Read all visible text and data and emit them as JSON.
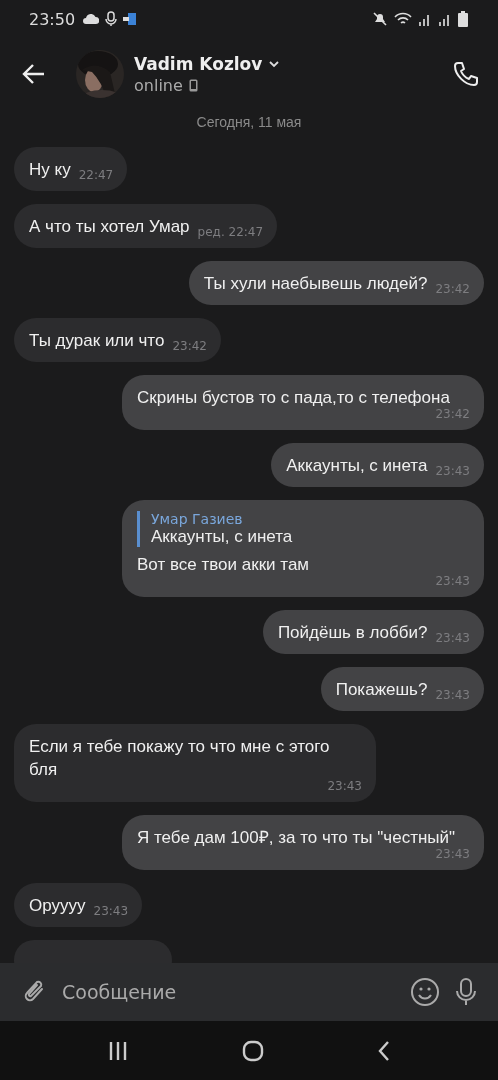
{
  "status_bar": {
    "time": "23:50"
  },
  "header": {
    "name": "Vadim Kozlov",
    "status": "online"
  },
  "date_separator": "Сегодня, 11 мая",
  "messages": [
    {
      "kind": "incoming",
      "text": "Ну ку",
      "time": "22:47"
    },
    {
      "kind": "incoming",
      "text": "А что ты хотел Умар",
      "time": "ред. 22:47"
    },
    {
      "kind": "outgoing",
      "text": "Ты хули наебывешь людей?",
      "time": "23:42"
    },
    {
      "kind": "incoming",
      "text": "Ты дурак или что",
      "time": "23:42"
    },
    {
      "kind": "outgoing",
      "text": "Скрины бустов  то с пада,то с телефона",
      "time": "23:42",
      "time_below": true
    },
    {
      "kind": "outgoing",
      "text": "Аккаунты, с инета",
      "time": "23:43"
    },
    {
      "kind": "outgoing",
      "reply": {
        "author": "Умар Газиев",
        "text": "Аккаунты, с инета"
      },
      "text": "Вот все твои акки там",
      "time": "23:43",
      "time_below": true
    },
    {
      "kind": "outgoing",
      "text": "Пойдёшь в лобби?",
      "time": "23:43"
    },
    {
      "kind": "outgoing",
      "text": "Покажешь?",
      "time": "23:43"
    },
    {
      "kind": "incoming",
      "text": "Если я тебе покажу то что мне с этого бля",
      "time": "23:43",
      "time_below": true
    },
    {
      "kind": "outgoing",
      "text": "Я тебе дам 100₽, за то что ты \"честный\"",
      "time": "23:43",
      "time_below": true
    },
    {
      "kind": "incoming",
      "text": "Оруууу",
      "time": "23:43"
    },
    {
      "kind": "incoming",
      "cut": true
    }
  ],
  "composer": {
    "placeholder": "Сообщение"
  }
}
